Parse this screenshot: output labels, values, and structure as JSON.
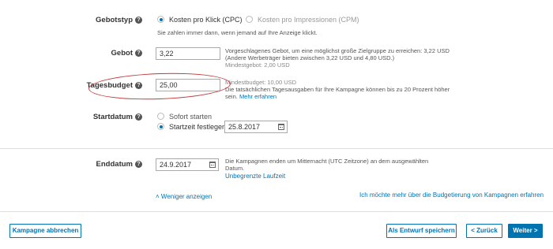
{
  "bid_type": {
    "label": "Gebotstyp",
    "option_cpc": "Kosten pro Klick (CPC)",
    "option_cpm": "Kosten pro Impressionen (CPM)",
    "hint": "Sie zahlen immer dann, wenn jemand auf Ihre Anzeige klickt."
  },
  "bid": {
    "label": "Gebot",
    "value": "3,22",
    "note_line1": "Vorgeschlagenes Gebot, um eine möglichst große Zielgruppe zu erreichen: 3,22 USD",
    "note_line2": "(Andere Werbeträger bieten zwischen 3,22 USD und 4,80 USD.)",
    "note_min": "Mindestgebot: 2,00 USD"
  },
  "daily_budget": {
    "label": "Tagesbudget",
    "value": "25,00",
    "note_min": "Mindestbudget: 10,00 USD",
    "note_line1": "Die tatsächlichen Tagesausgaben für Ihre Kampagne können bis zu 20 Prozent höher",
    "note_line2": "sein.",
    "learn_more": "Mehr erfahren"
  },
  "start_date": {
    "label": "Startdatum",
    "option_now": "Sofort starten",
    "option_set": "Startzeit festlegen",
    "value": "25.8.2017"
  },
  "end_date": {
    "label": "Enddatum",
    "value": "24.9.2017",
    "note_line1": "Die Kampagnen enden um Mitternacht (UTC Zeitzone) an dem ausgewählten",
    "note_line2": "Datum.",
    "unlimited_link": "Unbegrenzte Laufzeit"
  },
  "show_less": "Weniger anzeigen",
  "budget_info_link": "Ich möchte mehr über die Budgetierung von Kampagnen erfahren",
  "footer": {
    "cancel": "Kampagne abbrechen",
    "save_draft": "Als Entwurf speichern",
    "back": "< Zurück",
    "next": "Weiter >"
  },
  "colors": {
    "accent": "#0073b1",
    "highlight_ellipse": "#c0393b"
  }
}
